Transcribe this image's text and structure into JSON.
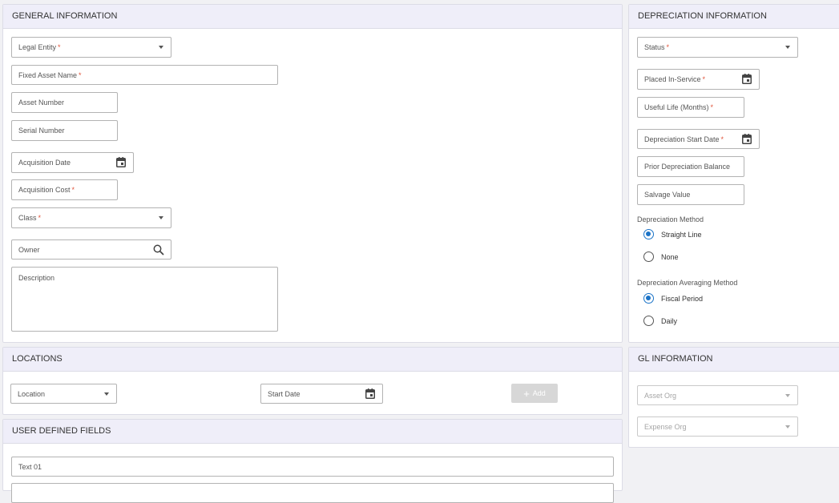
{
  "general": {
    "title": "GENERAL INFORMATION",
    "legal_entity": "Legal Entity",
    "fixed_asset_name": "Fixed Asset Name",
    "asset_number": "Asset Number",
    "serial_number": "Serial Number",
    "acquisition_date": "Acquisition Date",
    "acquisition_cost": "Acquisition Cost",
    "class": "Class",
    "owner": "Owner",
    "description": "Description",
    "required_mark": "*"
  },
  "depreciation": {
    "title": "DEPRECIATION INFORMATION",
    "status": "Status",
    "placed_in_service": "Placed In-Service",
    "useful_life": "Useful Life (Months)",
    "depreciation_start_date": "Depreciation Start Date",
    "prior_balance": "Prior Depreciation Balance",
    "salvage_value": "Salvage Value",
    "method_label": "Depreciation Method",
    "method_options": [
      "Straight Line",
      "None"
    ],
    "averaging_label": "Depreciation Averaging Method",
    "averaging_options": [
      "Fiscal Period",
      "Daily"
    ]
  },
  "locations": {
    "title": "LOCATIONS",
    "location": "Location",
    "start_date": "Start Date",
    "add_label": "Add",
    "add_icon": "+"
  },
  "gl": {
    "title": "GL INFORMATION",
    "asset_org": "Asset Org",
    "expense_org": "Expense Org"
  },
  "udf": {
    "title": "USER DEFINED FIELDS",
    "text01": "Text 01"
  },
  "colors": {
    "header_bg": "#efeef9",
    "accent": "#1b73c7",
    "required": "#e0553b"
  }
}
